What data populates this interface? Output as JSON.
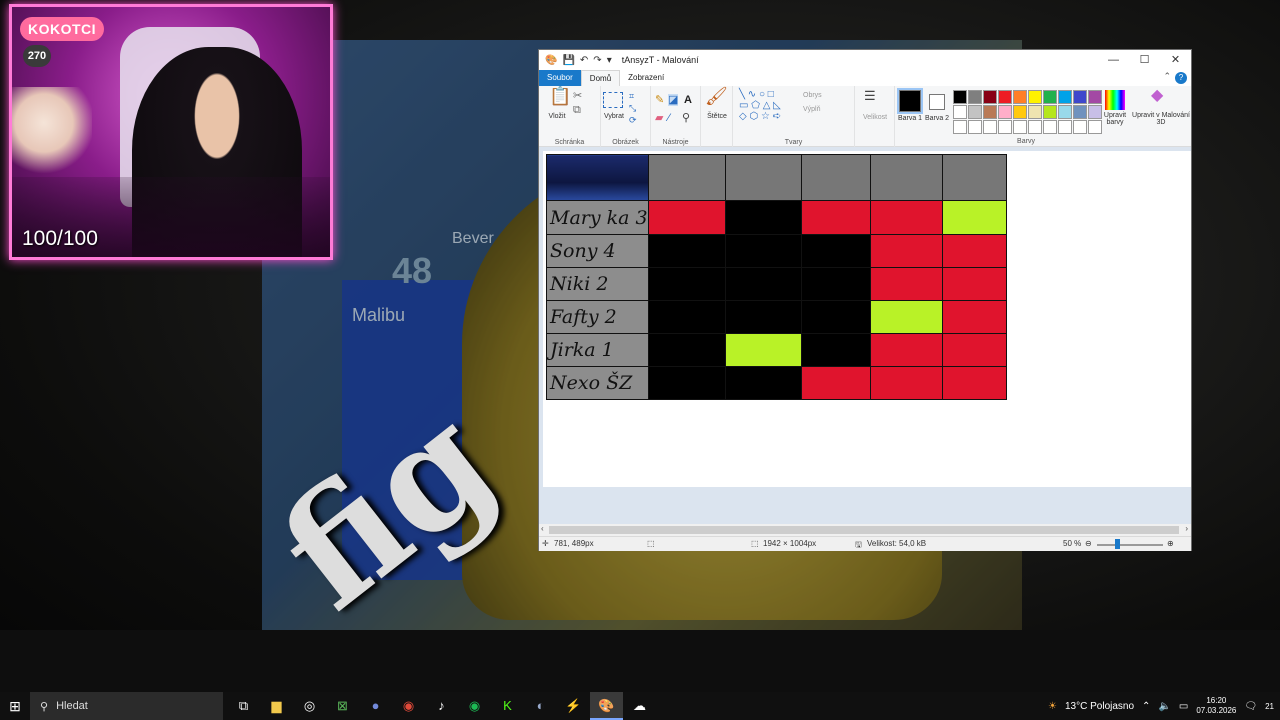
{
  "webcam": {
    "name_badge": "KOKOTCI",
    "count": "270",
    "hp": "100/100"
  },
  "background": {
    "map_number": "48",
    "map_city": "Malibu",
    "map_city2": "Bever",
    "overlay_text": "fig"
  },
  "paint": {
    "title": "tAnsyzT - Malování",
    "tabs": {
      "file": "Soubor",
      "home": "Domů",
      "view": "Zobrazení"
    },
    "ribbon": {
      "clipboard": {
        "paste": "Vložit",
        "group": "Schránka"
      },
      "image": {
        "select": "Vybrat",
        "group": "Obrázek"
      },
      "tools": {
        "group": "Nástroje"
      },
      "brushes": {
        "label": "Štětce"
      },
      "shapes": {
        "outline": "Obrys",
        "fill": "Výplň",
        "group": "Tvary"
      },
      "size": {
        "label": "Velikost"
      },
      "color1": {
        "label": "Barva 1"
      },
      "color2": {
        "label": "Barva 2"
      },
      "colors_group": "Barvy",
      "edit_colors": "Upravit barvy",
      "paint3d": "Upravit v Malování 3D",
      "palette": [
        "#000000",
        "#7f7f7f",
        "#880015",
        "#ed1c24",
        "#ff7f27",
        "#fff200",
        "#22b14c",
        "#00a2e8",
        "#3f48cc",
        "#a349a4",
        "#ffffff",
        "#c3c3c3",
        "#b97a57",
        "#ffaec9",
        "#ffc90e",
        "#efe4b0",
        "#b5e61d",
        "#99d9ea",
        "#7092be",
        "#c8bfe7",
        "#ffffff",
        "#ffffff",
        "#ffffff",
        "#ffffff",
        "#ffffff",
        "#ffffff",
        "#ffffff",
        "#ffffff",
        "#ffffff",
        "#ffffff"
      ]
    },
    "table": {
      "rows": [
        {
          "name": "Mary ka 3",
          "cells": [
            "red",
            "black",
            "red",
            "red",
            "lime"
          ]
        },
        {
          "name": "Sony 4",
          "cells": [
            "black",
            "black",
            "black",
            "red",
            "red"
          ]
        },
        {
          "name": "Niki 2",
          "cells": [
            "black",
            "black",
            "black",
            "red",
            "red"
          ]
        },
        {
          "name": "Fafty 2",
          "cells": [
            "black",
            "black",
            "black",
            "lime",
            "red"
          ]
        },
        {
          "name": "Jirka 1",
          "cells": [
            "black",
            "lime",
            "black",
            "red",
            "red"
          ]
        },
        {
          "name": "Nexo ŠZ",
          "cells": [
            "black",
            "black",
            "red",
            "red",
            "red"
          ]
        }
      ]
    },
    "status": {
      "cursor": "781, 489px",
      "dimensions": "1942 × 1004px",
      "size": "Velikost: 54,0 kB",
      "zoom": "50 %"
    }
  },
  "taskbar": {
    "search": "Hledat",
    "weather": "13°C  Polojasno",
    "time": "16:20",
    "date": "07.03.2026",
    "notif": "21"
  }
}
